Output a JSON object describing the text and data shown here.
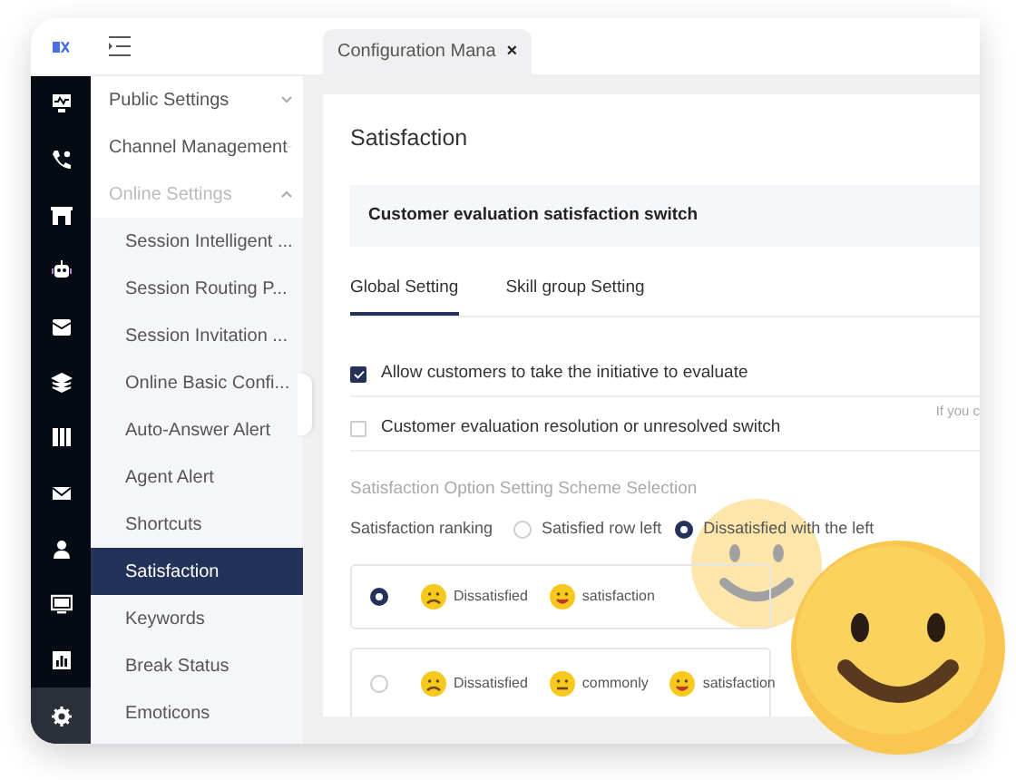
{
  "window": {
    "tab": {
      "label": "Configuration Mana",
      "close": "×",
      "selected": true
    }
  },
  "rail": [
    {
      "kind": "monitor",
      "selected": false
    },
    {
      "kind": "phone",
      "selected": false
    },
    {
      "kind": "store",
      "selected": false
    },
    {
      "kind": "robot",
      "selected": false
    },
    {
      "kind": "inbox",
      "selected": false
    },
    {
      "kind": "layers",
      "selected": false
    },
    {
      "kind": "book",
      "selected": false
    },
    {
      "kind": "mail",
      "selected": false
    },
    {
      "kind": "user",
      "selected": false
    },
    {
      "kind": "screen",
      "selected": false
    },
    {
      "kind": "chart",
      "selected": false
    },
    {
      "kind": "gear",
      "selected": true
    }
  ],
  "menu": [
    {
      "label": "Public Settings",
      "expanded": false
    },
    {
      "label": "Channel Management",
      "expanded": false
    },
    {
      "label": "Online Settings",
      "expanded": true,
      "children": [
        {
          "label": "Session Intelligent ...",
          "selected": false
        },
        {
          "label": "Session Routing P...",
          "selected": false
        },
        {
          "label": "Session Invitation ...",
          "selected": false
        },
        {
          "label": "Online Basic Confi...",
          "selected": false
        },
        {
          "label": "Auto-Answer Alert",
          "selected": false
        },
        {
          "label": "Agent Alert",
          "selected": false
        },
        {
          "label": "Shortcuts",
          "selected": false
        },
        {
          "label": "Satisfaction",
          "selected": true
        },
        {
          "label": "Keywords",
          "selected": false
        },
        {
          "label": "Break Status",
          "selected": false
        },
        {
          "label": "Emoticons",
          "selected": false
        }
      ]
    }
  ],
  "page": {
    "title": "Satisfaction",
    "switch_header": "Customer evaluation satisfaction switch",
    "tabs": [
      {
        "label": "Global Setting",
        "selected": true
      },
      {
        "label": "Skill group Setting",
        "selected": false
      }
    ],
    "options": [
      {
        "label": "Allow customers to take the initiative to evaluate",
        "checked": true
      },
      {
        "label": "Customer evaluation resolution or unresolved switch",
        "checked": false,
        "hint": "If you c"
      }
    ],
    "scheme_label": "Satisfaction Option Setting Scheme Selection",
    "ranking": {
      "label": "Satisfaction ranking",
      "choices": [
        {
          "label": "Satisfied row left",
          "selected": false
        },
        {
          "label": "Dissatisfied with the left",
          "selected": true
        }
      ]
    },
    "schemes": [
      {
        "selected": true,
        "faces": [
          {
            "kind": "sad",
            "label": "Dissatisfied"
          },
          {
            "kind": "happy",
            "label": "satisfaction"
          }
        ]
      },
      {
        "selected": false,
        "faces": [
          {
            "kind": "sad",
            "label": "Dissatisfied"
          },
          {
            "kind": "neutral",
            "label": "commonly"
          },
          {
            "kind": "happy",
            "label": "satisfaction"
          }
        ]
      }
    ]
  }
}
